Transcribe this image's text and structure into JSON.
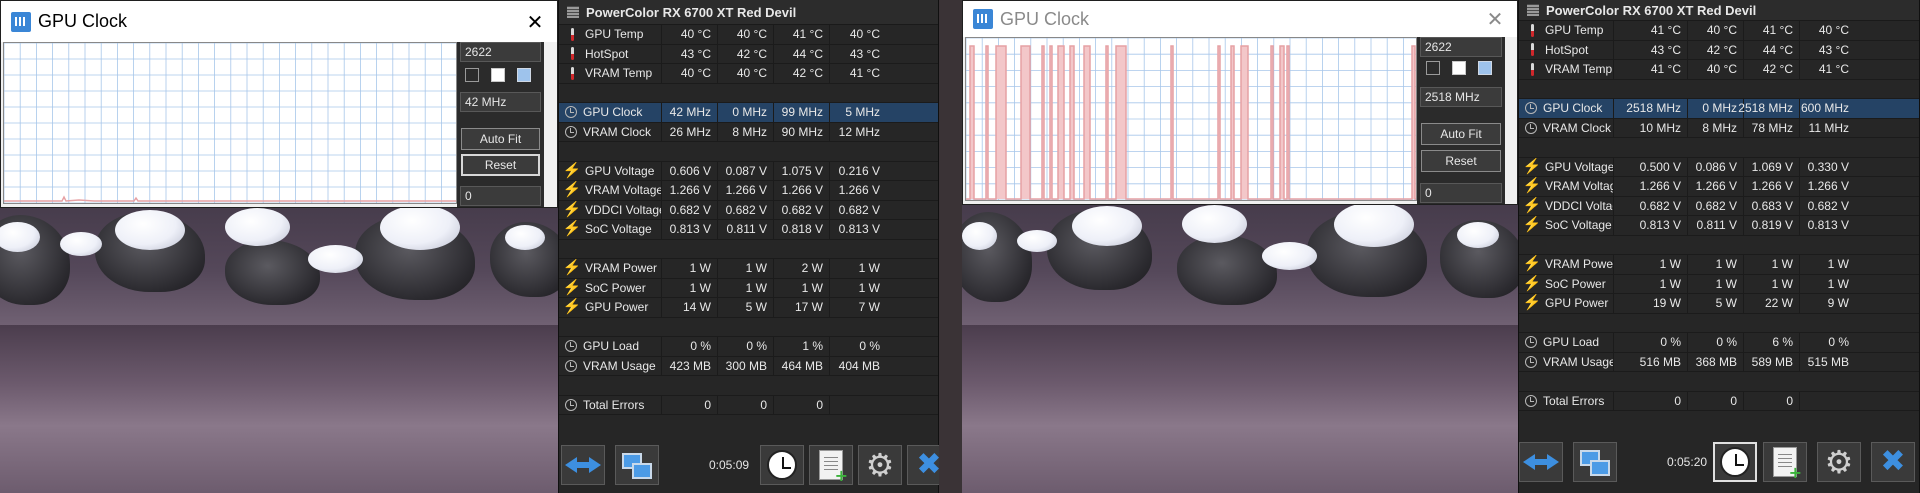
{
  "screens": [
    {
      "graph_window": {
        "title": "GPU Clock",
        "state": "active",
        "max_value": "2622",
        "current_value": "42 MHz",
        "min_value": "0",
        "autofit_label": "Auto Fit",
        "reset_label": "Reset",
        "plot": {
          "line_color": "#e6a1a4",
          "grid_color": "#a7c6ea",
          "trace": "low"
        }
      },
      "panel": {
        "device": "PowerColor RX 6700 XT Red Devil",
        "elapsed": "0:05:09",
        "groups": [
          [
            {
              "icon": "therm",
              "label": "GPU Temp",
              "values": [
                "40 °C",
                "40 °C",
                "41 °C",
                "40 °C"
              ]
            },
            {
              "icon": "therm",
              "label": "HotSpot",
              "values": [
                "43 °C",
                "42 °C",
                "44 °C",
                "43 °C"
              ]
            },
            {
              "icon": "therm",
              "label": "VRAM Temp",
              "values": [
                "40 °C",
                "40 °C",
                "42 °C",
                "41 °C"
              ]
            }
          ],
          [
            {
              "icon": "clock",
              "label": "GPU Clock",
              "selected": true,
              "values": [
                "42 MHz",
                "0 MHz",
                "99 MHz",
                "5 MHz"
              ]
            },
            {
              "icon": "clock",
              "label": "VRAM Clock",
              "values": [
                "26 MHz",
                "8 MHz",
                "90 MHz",
                "12 MHz"
              ]
            }
          ],
          [
            {
              "icon": "bolt",
              "label": "GPU Voltage",
              "values": [
                "0.606 V",
                "0.087 V",
                "1.075 V",
                "0.216 V"
              ]
            },
            {
              "icon": "bolt",
              "label": "VRAM Voltage",
              "values": [
                "1.266 V",
                "1.266 V",
                "1.266 V",
                "1.266 V"
              ]
            },
            {
              "icon": "bolt",
              "label": "VDDCI Voltage",
              "values": [
                "0.682 V",
                "0.682 V",
                "0.682 V",
                "0.682 V"
              ]
            },
            {
              "icon": "bolt",
              "label": "SoC Voltage",
              "values": [
                "0.813 V",
                "0.811 V",
                "0.818 V",
                "0.813 V"
              ]
            }
          ],
          [
            {
              "icon": "bolt",
              "label": "VRAM Power",
              "values": [
                "1 W",
                "1 W",
                "2 W",
                "1 W"
              ]
            },
            {
              "icon": "bolt",
              "label": "SoC Power",
              "values": [
                "1 W",
                "1 W",
                "1 W",
                "1 W"
              ]
            },
            {
              "icon": "bolt",
              "label": "GPU Power",
              "values": [
                "14 W",
                "5 W",
                "17 W",
                "7 W"
              ]
            }
          ],
          [
            {
              "icon": "clock",
              "label": "GPU Load",
              "values": [
                "0 %",
                "0 %",
                "1 %",
                "0 %"
              ]
            },
            {
              "icon": "clock",
              "label": "VRAM Usage",
              "values": [
                "423 MB",
                "300 MB",
                "464 MB",
                "404 MB"
              ]
            }
          ],
          [
            {
              "icon": "clock",
              "label": "Total Errors",
              "values": [
                "0",
                "0",
                "0",
                ""
              ]
            }
          ]
        ]
      }
    },
    {
      "graph_window": {
        "title": "GPU Clock",
        "state": "inactive",
        "max_value": "2622",
        "current_value": "2518 MHz",
        "min_value": "0",
        "autofit_label": "Auto Fit",
        "reset_label": "Reset",
        "plot": {
          "line_color": "#e6a1a4",
          "grid_color": "#a7c6ea",
          "trace": "spiky"
        }
      },
      "panel": {
        "device": "PowerColor RX 6700 XT Red Devil",
        "elapsed": "0:05:20",
        "groups": [
          [
            {
              "icon": "therm",
              "label": "GPU Temp",
              "values": [
                "41 °C",
                "40 °C",
                "41 °C",
                "40 °C"
              ]
            },
            {
              "icon": "therm",
              "label": "HotSpot",
              "values": [
                "43 °C",
                "42 °C",
                "44 °C",
                "43 °C"
              ]
            },
            {
              "icon": "therm",
              "label": "VRAM Temp",
              "values": [
                "41 °C",
                "40 °C",
                "42 °C",
                "41 °C"
              ]
            }
          ],
          [
            {
              "icon": "clock",
              "label": "GPU Clock",
              "selected": true,
              "values": [
                "2518 MHz",
                "0 MHz",
                "2518 MHz",
                "600 MHz"
              ]
            },
            {
              "icon": "clock",
              "label": "VRAM Clock",
              "values": [
                "10 MHz",
                "8 MHz",
                "78 MHz",
                "11 MHz"
              ]
            }
          ],
          [
            {
              "icon": "bolt",
              "label": "GPU Voltage",
              "values": [
                "0.500 V",
                "0.086 V",
                "1.069 V",
                "0.330 V"
              ]
            },
            {
              "icon": "bolt",
              "label": "VRAM Voltage",
              "values": [
                "1.266 V",
                "1.266 V",
                "1.266 V",
                "1.266 V"
              ]
            },
            {
              "icon": "bolt",
              "label": "VDDCI Voltage",
              "values": [
                "0.682 V",
                "0.682 V",
                "0.683 V",
                "0.682 V"
              ]
            },
            {
              "icon": "bolt",
              "label": "SoC Voltage",
              "values": [
                "0.813 V",
                "0.811 V",
                "0.819 V",
                "0.813 V"
              ]
            }
          ],
          [
            {
              "icon": "bolt",
              "label": "VRAM Power",
              "values": [
                "1 W",
                "1 W",
                "1 W",
                "1 W"
              ]
            },
            {
              "icon": "bolt",
              "label": "SoC Power",
              "values": [
                "1 W",
                "1 W",
                "1 W",
                "1 W"
              ]
            },
            {
              "icon": "bolt",
              "label": "GPU Power",
              "values": [
                "19 W",
                "5 W",
                "22 W",
                "9 W"
              ]
            }
          ],
          [
            {
              "icon": "clock",
              "label": "GPU Load",
              "values": [
                "0 %",
                "0 %",
                "6 %",
                "0 %"
              ]
            },
            {
              "icon": "clock",
              "label": "VRAM Usage",
              "values": [
                "516 MB",
                "368 MB",
                "589 MB",
                "515 MB"
              ]
            }
          ],
          [
            {
              "icon": "clock",
              "label": "Total Errors",
              "values": [
                "0",
                "0",
                "0",
                ""
              ]
            }
          ]
        ]
      }
    }
  ]
}
